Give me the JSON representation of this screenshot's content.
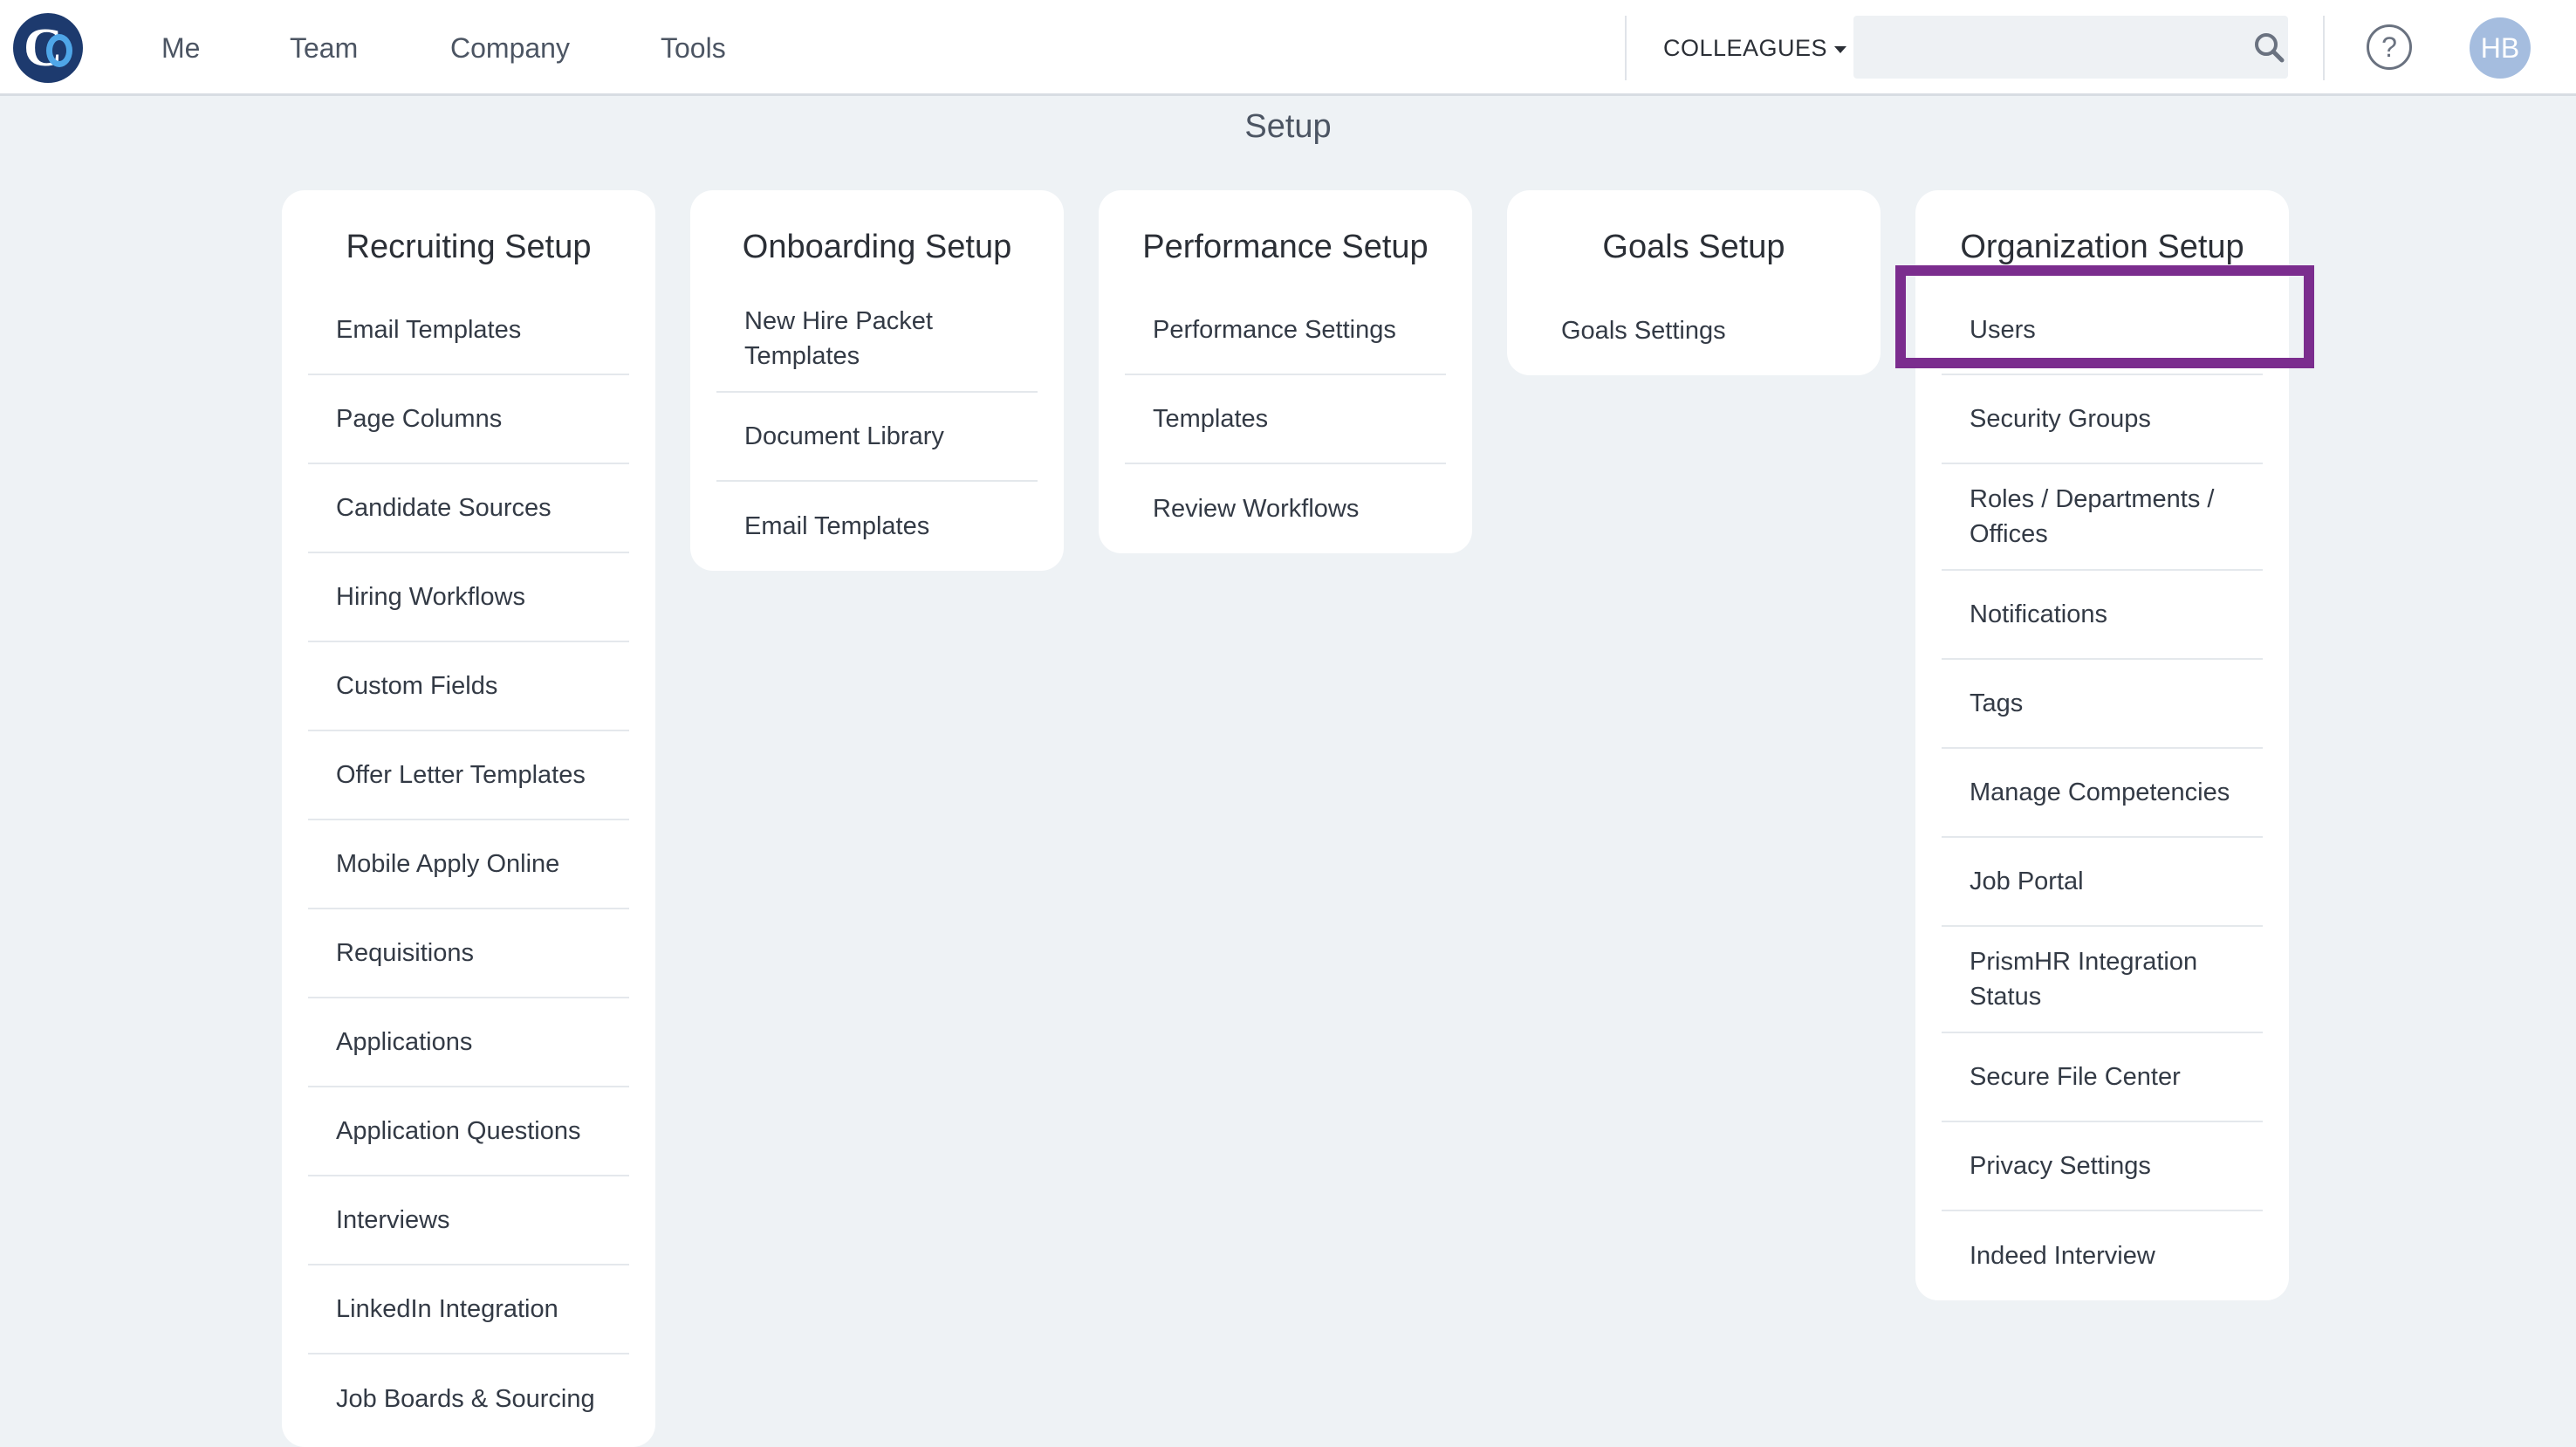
{
  "nav": {
    "links": [
      "Me",
      "Team",
      "Company",
      "Tools"
    ],
    "colleagues_label": "COLLEAGUES",
    "search_placeholder": "",
    "help_label": "?",
    "avatar_initials": "HB"
  },
  "page_title": "Setup",
  "cards": [
    {
      "title": "Recruiting Setup",
      "items": [
        "Email Templates",
        "Page Columns",
        "Candidate Sources",
        "Hiring Workflows",
        "Custom Fields",
        "Offer Letter Templates",
        "Mobile Apply Online",
        "Requisitions",
        "Applications",
        "Application Questions",
        "Interviews",
        "LinkedIn Integration",
        "Job Boards & Sourcing"
      ]
    },
    {
      "title": "Onboarding Setup",
      "items": [
        "New Hire Packet Templates",
        "Document Library",
        "Email Templates"
      ]
    },
    {
      "title": "Performance Setup",
      "items": [
        "Performance Settings",
        "Templates",
        "Review Workflows"
      ]
    },
    {
      "title": "Goals Setup",
      "items": [
        "Goals Settings"
      ]
    },
    {
      "title": "Organization Setup",
      "items": [
        "Users",
        "Security Groups",
        "Roles / Departments / Offices",
        "Notifications",
        "Tags",
        "Manage Competencies",
        "Job Portal",
        "PrismHR Integration Status",
        "Secure File Center",
        "Privacy Settings",
        "Indeed Interview"
      ]
    }
  ],
  "colors": {
    "highlight": "#7b2d8e",
    "background": "#eef2f5",
    "logo": "#1d3a6e"
  }
}
